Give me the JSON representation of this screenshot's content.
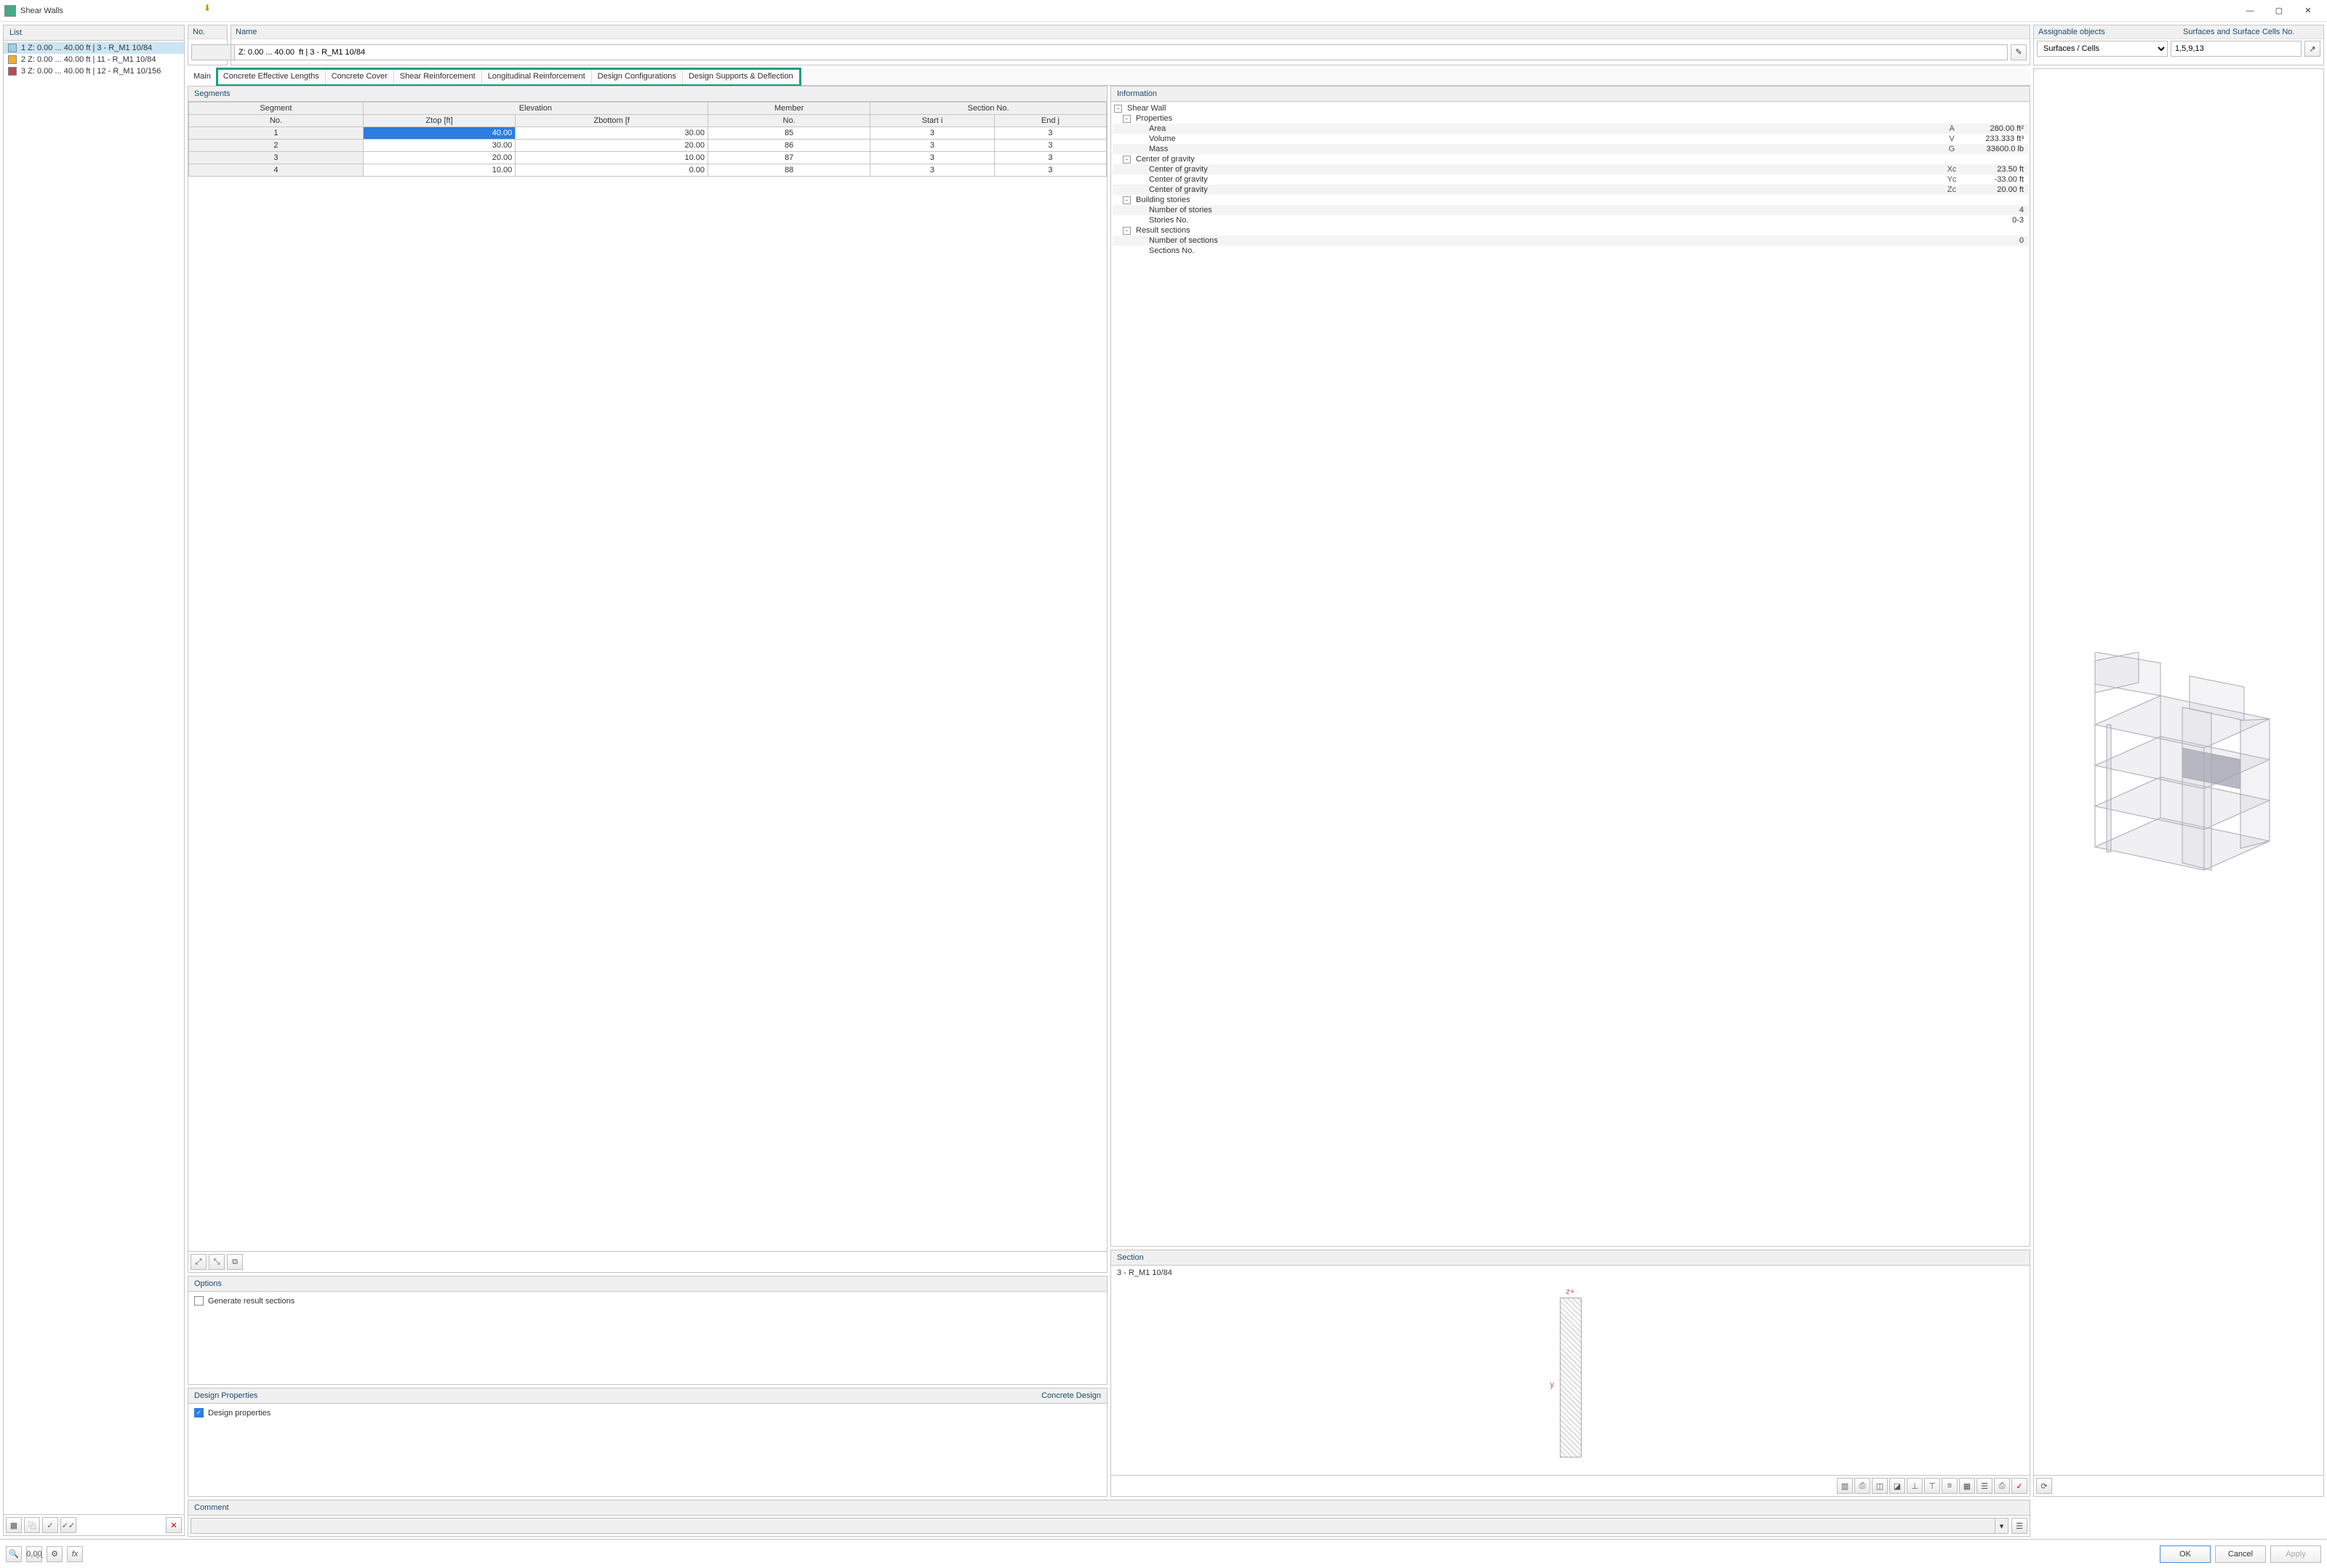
{
  "window": {
    "title": "Shear Walls"
  },
  "list": {
    "header": "List",
    "items": [
      {
        "color": "#9ad0e8",
        "label": "1 Z: 0.00 ... 40.00 ft | 3 - R_M1 10/84",
        "selected": true
      },
      {
        "color": "#f0b030",
        "label": "2 Z: 0.00 ... 40.00 ft | 11 - R_M1 10/84",
        "selected": false
      },
      {
        "color": "#b05050",
        "label": "3 Z: 0.00 ... 40.00 ft | 12 - R_M1 10/156",
        "selected": false
      }
    ]
  },
  "header": {
    "no_label": "No.",
    "no_value": "",
    "name_label": "Name",
    "name_value": "Z: 0.00 ... 40.00  ft | 3 - R_M1 10/84",
    "assignable_label": "Assignable objects",
    "assignable_value": "Surfaces / Cells",
    "surfaces_label": "Surfaces and Surface Cells No.",
    "surfaces_value": "1,5,9,13"
  },
  "tabs": [
    "Main",
    "Concrete Effective Lengths",
    "Concrete Cover",
    "Shear Reinforcement",
    "Longitudinal Reinforcement",
    "Design Configurations",
    "Design Supports & Deflection"
  ],
  "segments": {
    "header": "Segments",
    "columns_top": [
      "Segment",
      "Elevation",
      "Member",
      "Section No."
    ],
    "columns_sub": [
      "No.",
      "Ztop [ft]",
      "Zbottom [f",
      "No.",
      "Start i",
      "End j"
    ],
    "rows": [
      {
        "no": "1",
        "ztop": "40.00",
        "zbot": "30.00",
        "mem": "85",
        "si": "3",
        "ej": "3",
        "sel": true
      },
      {
        "no": "2",
        "ztop": "30.00",
        "zbot": "20.00",
        "mem": "86",
        "si": "3",
        "ej": "3"
      },
      {
        "no": "3",
        "ztop": "20.00",
        "zbot": "10.00",
        "mem": "87",
        "si": "3",
        "ej": "3"
      },
      {
        "no": "4",
        "ztop": "10.00",
        "zbot": "0.00",
        "mem": "88",
        "si": "3",
        "ej": "3"
      }
    ]
  },
  "options": {
    "header": "Options",
    "gen": "Generate result sections"
  },
  "design": {
    "header": "Design Properties",
    "right": "Concrete Design",
    "chk": "Design properties"
  },
  "info": {
    "header": "Information",
    "root": "Shear Wall",
    "groups": [
      {
        "name": "Properties",
        "rows": [
          {
            "k": "Area",
            "s": "A",
            "v": "280.00 ft²"
          },
          {
            "k": "Volume",
            "s": "V",
            "v": "233.333 ft³"
          },
          {
            "k": "Mass",
            "s": "G",
            "v": "33600.0 lb"
          }
        ]
      },
      {
        "name": "Center of gravity",
        "rows": [
          {
            "k": "Center of gravity",
            "s": "Xc",
            "v": "23.50 ft"
          },
          {
            "k": "Center of gravity",
            "s": "Yc",
            "v": "-33.00 ft"
          },
          {
            "k": "Center of gravity",
            "s": "Zc",
            "v": "20.00 ft"
          }
        ]
      },
      {
        "name": "Building stories",
        "rows": [
          {
            "k": "Number of stories",
            "s": "",
            "v": "4"
          },
          {
            "k": "Stories No.",
            "s": "",
            "v": "0-3"
          }
        ]
      },
      {
        "name": "Result sections",
        "rows": [
          {
            "k": "Number of sections",
            "s": "",
            "v": "0"
          },
          {
            "k": "Sections No.",
            "s": "",
            "v": ""
          }
        ]
      }
    ]
  },
  "section": {
    "header": "Section",
    "name": "3 - R_M1 10/84",
    "zlabel": "z+",
    "ylabel": "y"
  },
  "comment": {
    "header": "Comment",
    "value": ""
  },
  "buttons": {
    "ok": "OK",
    "cancel": "Cancel",
    "apply": "Apply"
  }
}
